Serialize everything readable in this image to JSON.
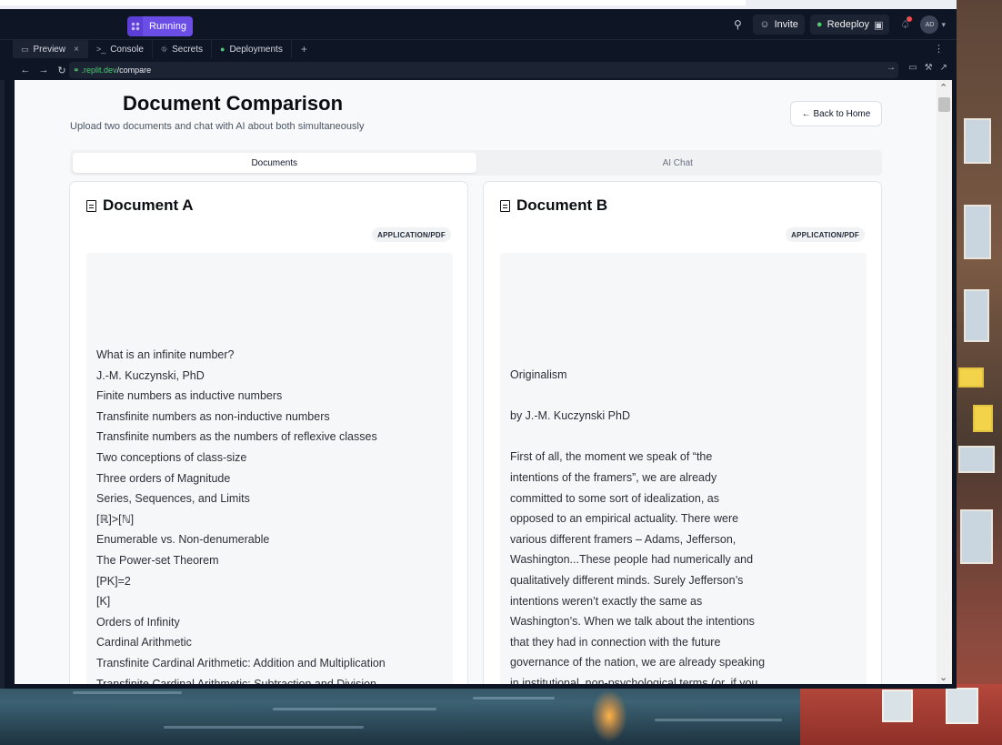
{
  "app": {
    "run_status": "Running",
    "invite_label": "Invite",
    "redeploy_label": "Redeploy",
    "avatar_initials": "AD"
  },
  "tabs": [
    {
      "label": "Preview",
      "icon": "monitor-icon"
    },
    {
      "label": "Console",
      "icon": "terminal-icon"
    },
    {
      "label": "Secrets",
      "icon": "lock-icon"
    },
    {
      "label": "Deployments",
      "icon": "deploy-icon"
    }
  ],
  "url": {
    "host": ".replit.dev",
    "path": "/compare"
  },
  "page": {
    "title": "Document Comparison",
    "subtitle": "Upload two documents and chat with AI about both simultaneously",
    "back_label": "← Back to Home",
    "seg_tabs": [
      "Documents",
      "AI Chat"
    ],
    "active_seg": "Documents"
  },
  "doc_a": {
    "title": "Document A",
    "mime": "APPLICATION/PDF",
    "lines": [
      "What is an infinite number?",
      "J.-M. Kuczynski, PhD",
      "Finite numbers as inductive numbers",
      "Transfinite numbers as non-inductive numbers",
      "Transfinite numbers as the numbers of reflexive classes",
      "Two conceptions of class-size",
      "Three orders of Magnitude",
      "Series, Sequences, and Limits",
      "[ℝ]>[ℕ]",
      "Enumerable vs. Non-denumerable",
      "The Power-set Theorem",
      "[PK]=2",
      "[K]",
      "Orders of Infinity",
      "Cardinal Arithmetic",
      "Transfinite Cardinal Arithmetic: Addition and Multiplication",
      "Transfinite Cardinal Arithmetic: Subtraction and Division"
    ]
  },
  "doc_b": {
    "title": "Document B",
    "mime": "APPLICATION/PDF",
    "lines": [
      "Originalism",
      "",
      "by J.-M. Kuczynski PhD",
      "",
      "First of all, the moment we speak of “the",
      "intentions of the framers”, we are already",
      "committed to some sort of idealization, as",
      "opposed to an empirical actuality. There were",
      "various different framers – Adams, Jefferson,",
      "Washington...These people had numerically and",
      "qualitatively different minds. Surely Jefferson’s",
      "intentions weren’t exactly the same as",
      "Washington’s. When we talk about the intentions",
      "that they had in connection with the future",
      "governance of the nation, we are already speaking",
      "in institutional, non-psychological terms (or, if you"
    ]
  },
  "colors": {
    "accent_purple": "#6a4ee6",
    "replit_green": "#4ecb71",
    "ide_dark": "#0e1525"
  }
}
